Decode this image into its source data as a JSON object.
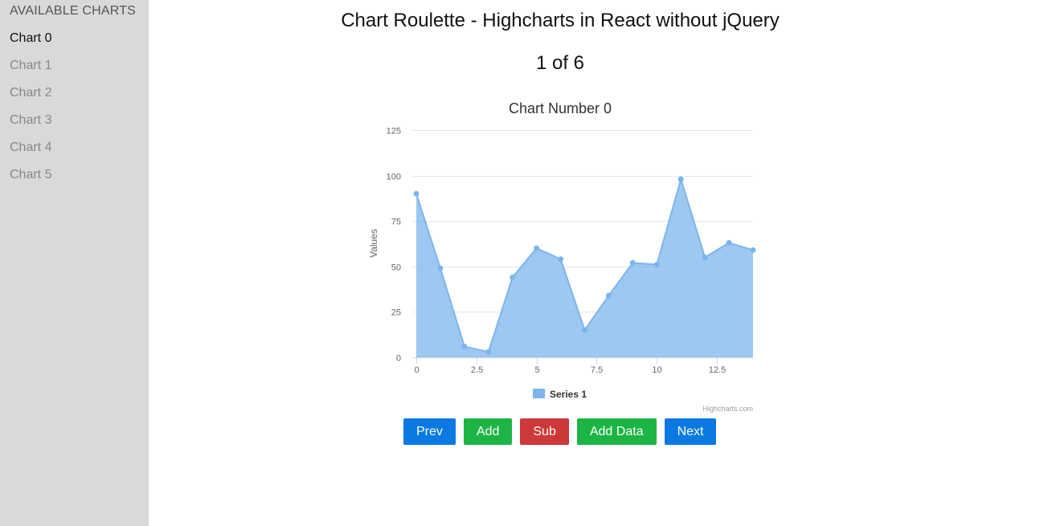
{
  "sidebar": {
    "heading": "AVAILABLE CHARTS",
    "items": [
      "Chart 0",
      "Chart 1",
      "Chart 2",
      "Chart 3",
      "Chart 4",
      "Chart 5"
    ],
    "active_index": 0
  },
  "page": {
    "title": "Chart Roulette - Highcharts in React without jQuery",
    "counter": "1 of 6"
  },
  "chart_data": {
    "type": "area",
    "title": "Chart Number 0",
    "ylabel": "Values",
    "xlabel": "",
    "ylim": [
      0,
      125
    ],
    "xlim": [
      0,
      14
    ],
    "yticks": [
      "0",
      "25",
      "50",
      "75",
      "100",
      "125"
    ],
    "xticks": [
      "0",
      "2.5",
      "5",
      "7.5",
      "10",
      "12.5"
    ],
    "grid": true,
    "legend_position": "bottom-center",
    "credits": "Highcharts.com",
    "series": [
      {
        "name": "Series 1",
        "color": "#7cb5ec",
        "x": [
          0,
          1,
          2,
          3,
          4,
          5,
          6,
          7,
          8,
          9,
          10,
          11,
          12,
          13,
          14
        ],
        "values": [
          90,
          49,
          6,
          3,
          44,
          60,
          54,
          15,
          34,
          52,
          51,
          98,
          55,
          63,
          59
        ]
      }
    ]
  },
  "buttons": {
    "prev": "Prev",
    "add": "Add",
    "sub": "Sub",
    "add_data": "Add Data",
    "next": "Next"
  },
  "colors": {
    "sidebar_bg": "#d9d9d9",
    "blue": "#0a7ae2",
    "green": "#1db446",
    "red": "#cd3838"
  }
}
